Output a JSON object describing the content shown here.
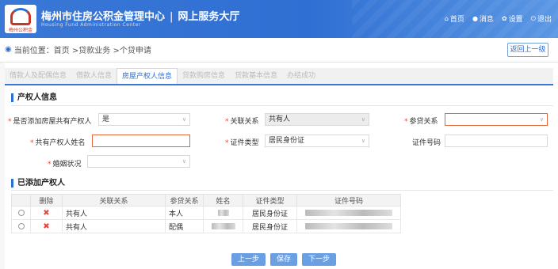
{
  "header": {
    "logo_text": "梅州公积金",
    "title": "梅州市住房公积金管理中心",
    "separator": "|",
    "subtitle": "网上服务大厅",
    "tagline": "Housing Fund Administration Center",
    "nav": [
      {
        "icon": "home-icon",
        "glyph": "⌂",
        "label": "首页"
      },
      {
        "icon": "message-icon",
        "glyph": "●",
        "label": "消息"
      },
      {
        "icon": "gear-icon",
        "glyph": "✿",
        "label": "设置"
      },
      {
        "icon": "power-icon",
        "glyph": "⏻",
        "label": "退出"
      }
    ]
  },
  "breadcrumb": {
    "prefix": "当前位置：",
    "path": "首页 >贷款业务 >个贷申请",
    "back_label": "返回上一级"
  },
  "tabs": [
    {
      "label": "借款人及配偶信息",
      "active": false
    },
    {
      "label": "借款人信息",
      "active": false
    },
    {
      "label": "房屋产权人信息",
      "active": true
    },
    {
      "label": "贷款购房信息",
      "active": false
    },
    {
      "label": "贷款基本信息",
      "active": false
    },
    {
      "label": "办结成功",
      "active": false
    }
  ],
  "owner_info": {
    "section_title": "产权人信息",
    "add_owner_label": "是否添加房屋共有产权人",
    "add_owner_value": "是",
    "relation_label": "关联关系",
    "relation_value": "共有人",
    "loan_relation_label": "参贷关系",
    "loan_relation_value": "",
    "owner_name_label": "共有产权人姓名",
    "owner_name_value": "",
    "id_type_label": "证件类型",
    "id_type_value": "居民身份证",
    "id_number_label": "证件号码",
    "id_number_value": "",
    "marital_label": "婚姻状况",
    "marital_value": ""
  },
  "added_owners": {
    "section_title": "已添加产权人",
    "columns": [
      "删除",
      "关联关系",
      "参贷关系",
      "姓名",
      "证件类型",
      "证件号码"
    ],
    "rows": [
      {
        "relation": "共有人",
        "loan_relation": "本人",
        "id_type": "居民身份证"
      },
      {
        "relation": "共有人",
        "loan_relation": "配偶",
        "id_type": "居民身份证"
      }
    ],
    "delete_glyph": "✖"
  },
  "buttons": {
    "prev": "上一步",
    "save": "保存",
    "next": "下一步"
  },
  "colors": {
    "header_blue": "#3a78d6",
    "accent": "#2f6fd3",
    "required": "#e2463b",
    "button": "#6a9fe3"
  }
}
